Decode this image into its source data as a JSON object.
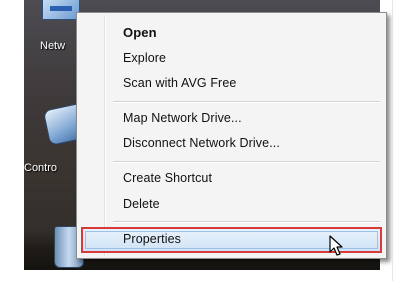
{
  "desktop": {
    "icons": [
      {
        "label": "Netw",
        "icon": "network-icon"
      },
      {
        "label": "Contro",
        "icon": "control-panel-icon"
      },
      {
        "label": "",
        "icon": "recycle-bin-icon"
      }
    ]
  },
  "context_menu": {
    "items": [
      {
        "label": "Open",
        "bold": true
      },
      {
        "label": "Explore"
      },
      {
        "label": "Scan with AVG Free"
      },
      {
        "label": "Map Network Drive..."
      },
      {
        "label": "Disconnect Network Drive..."
      },
      {
        "label": "Create Shortcut"
      },
      {
        "label": "Delete"
      },
      {
        "label": "Properties",
        "highlighted": true
      }
    ]
  },
  "colors": {
    "highlight_outline": "#d83a3a",
    "hover_fill": "#cfe2f6"
  }
}
